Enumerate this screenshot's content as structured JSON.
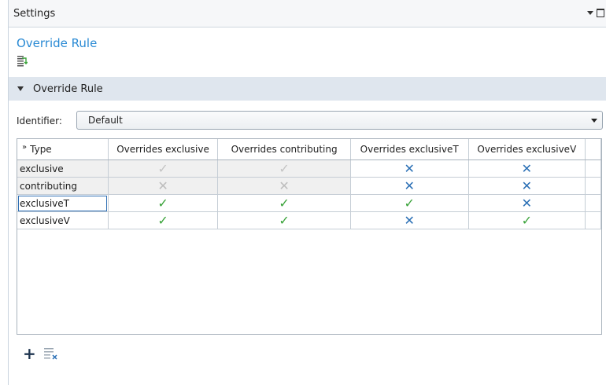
{
  "window": {
    "title": "Settings"
  },
  "node": {
    "title": "Override Rule",
    "build_icon": "build-selected-icon"
  },
  "section": {
    "label": "Override Rule"
  },
  "identifier": {
    "label": "Identifier:",
    "value": "Default"
  },
  "table": {
    "columns": [
      "Type",
      "Overrides exclusive",
      "Overrides contributing",
      "Overrides exclusiveT",
      "Overrides exclusiveV"
    ],
    "rows": [
      {
        "type": "exclusive",
        "cells": [
          "check-grey",
          "check-grey",
          "cross-blue",
          "cross-blue"
        ]
      },
      {
        "type": "contributing",
        "cells": [
          "cross-grey",
          "cross-grey",
          "cross-blue",
          "cross-blue"
        ]
      },
      {
        "type": "exclusiveT",
        "cells": [
          "check-green",
          "check-green",
          "check-green",
          "cross-blue"
        ]
      },
      {
        "type": "exclusiveV",
        "cells": [
          "check-green",
          "check-green",
          "cross-blue",
          "check-green"
        ]
      }
    ],
    "selected_row": 2
  },
  "toolbar": {
    "add_icon": "plus-icon",
    "clear_icon": "clear-list-icon"
  },
  "colors": {
    "accent": "#2a8ad4",
    "check": "#3aa33a",
    "cross": "#2a6fb5",
    "section_bg": "#dfe6ee"
  }
}
